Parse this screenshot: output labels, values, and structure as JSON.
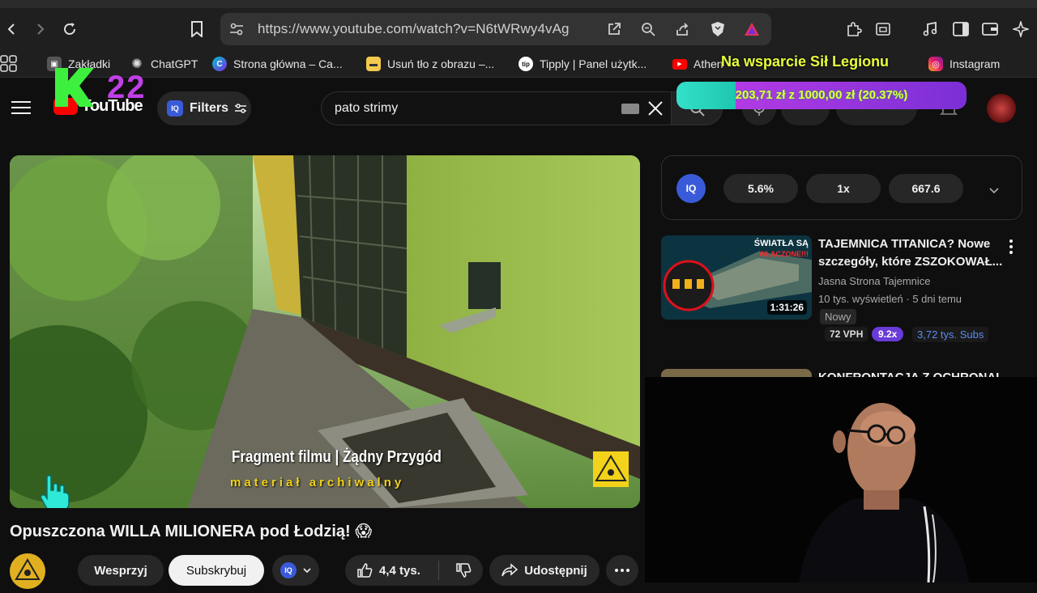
{
  "browser": {
    "url": "https://www.youtube.com/watch?v=N6tWRwy4vAg",
    "bookmarks": [
      {
        "label": "Zakładki"
      },
      {
        "label": "ChatGPT"
      },
      {
        "label": "Strona główna – Ca..."
      },
      {
        "label": "Usuń tło z obrazu –..."
      },
      {
        "label": "Tipply | Panel użytk..."
      },
      {
        "label": "Athen"
      },
      {
        "label": "Instagram"
      }
    ]
  },
  "overlay": {
    "logo_number": "22",
    "support_title": "Na wsparcie Sił Legionu",
    "donation_text": "203,71 zł z 1000,00 zł (20.37%)",
    "donation_progress": 0.2037
  },
  "youtube": {
    "filters_label": "Filters",
    "search_value": "pato strimy",
    "logo_text": "YouTube"
  },
  "video": {
    "caption_line1": "Fragment filmu | Żądny Przygód",
    "caption_line2": "materiał archiwalny",
    "title": "Opuszczona WILLA MILIONERA pod Łodzią! 😱"
  },
  "actions": {
    "support_label": "Wesprzyj",
    "subscribe_label": "Subskrybuj",
    "like_count": "4,4 tys.",
    "share_label": "Udostępnij"
  },
  "iq_panel": {
    "stat1": "5.6%",
    "stat2": "1x",
    "stat3": "667.6"
  },
  "recommendations": [
    {
      "title": "TAJEMNICA TITANICA? Nowe szczegóły, które ZSZOKOWAŁ...",
      "channel": "Jasna Strona Tajemnice",
      "meta": "10 tys. wyświetleń · 5 dni temu",
      "badge": "Nowy",
      "duration": "1:31:26",
      "thumb_text_line1": "ŚWIATŁA SĄ",
      "thumb_text_line2": "WŁĄCZONE!!!",
      "vph": "72 VPH",
      "multiplier": "9.2x",
      "subs": "3,72 tys. Subs"
    },
    {
      "title": "KONFRONTACJA Z OCHRONAI"
    }
  ]
}
